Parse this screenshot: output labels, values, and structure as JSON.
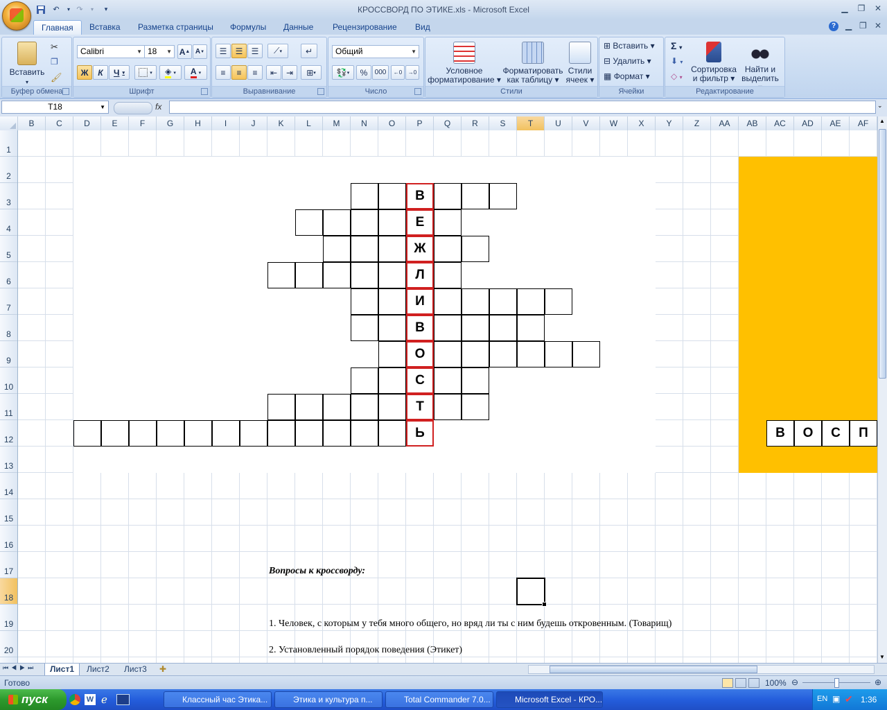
{
  "window": {
    "title": "КРОССВОРД ПО ЭТИКЕ.xls - Microsoft Excel",
    "quick_access_icons": [
      "save-icon",
      "undo-icon",
      "redo-icon",
      "customize-icon"
    ]
  },
  "ribbon": {
    "tabs": [
      "Главная",
      "Вставка",
      "Разметка страницы",
      "Формулы",
      "Данные",
      "Рецензирование",
      "Вид"
    ],
    "active_tab": "Главная",
    "groups": {
      "clipboard": {
        "label": "Буфер обмена",
        "paste": "Вставить"
      },
      "font": {
        "label": "Шрифт",
        "font_name": "Calibri",
        "font_size": "18",
        "bold": "Ж",
        "italic": "К",
        "underline": "Ч",
        "grow": "A",
        "shrink": "A",
        "font_color": "A"
      },
      "alignment": {
        "label": "Выравнивание"
      },
      "number": {
        "label": "Число",
        "format": "Общий",
        "percent": "%",
        "thousands": "000"
      },
      "styles": {
        "label": "Стили",
        "conditional": "Условное форматирование",
        "as_table": "Форматировать как таблицу",
        "cell_styles": "Стили ячеек"
      },
      "cells": {
        "label": "Ячейки",
        "insert": "Вставить",
        "delete": "Удалить",
        "format": "Формат"
      },
      "editing": {
        "label": "Редактирование",
        "sum": "Σ",
        "sort": "Сортировка и фильтр",
        "find": "Найти и выделить"
      }
    }
  },
  "formula_bar": {
    "name_box": "T18",
    "fx": "fx",
    "value": ""
  },
  "columns": [
    "B",
    "C",
    "D",
    "E",
    "F",
    "G",
    "H",
    "I",
    "J",
    "K",
    "L",
    "M",
    "N",
    "O",
    "P",
    "Q",
    "R",
    "S",
    "T",
    "U",
    "V",
    "W",
    "X",
    "Y",
    "Z",
    "AA",
    "AB",
    "AC",
    "AD",
    "AE",
    "AF"
  ],
  "selected_column": "T",
  "rows": [
    "1",
    "2",
    "3",
    "4",
    "5",
    "6",
    "7",
    "8",
    "9",
    "10",
    "11",
    "12",
    "13",
    "14",
    "15",
    "16",
    "17",
    "18",
    "19",
    "20"
  ],
  "selected_row": "18",
  "crossword": {
    "keyword": "ВЕЖЛИВОСТЬ",
    "keyword_letters": [
      "В",
      "Е",
      "Ж",
      "Л",
      "И",
      "В",
      "О",
      "С",
      "Т",
      "Ь"
    ],
    "right_letters": [
      "В",
      "О",
      "С",
      "П"
    ],
    "highlight_color": "#ffc000",
    "keyword_border_color": "#d02020"
  },
  "questions": {
    "heading": "Вопросы к кроссворду:",
    "items": [
      "1. Человек, с которым у тебя много общего, но вряд ли ты с ним будешь откровенным. (Товарищ)",
      "2. Установленный порядок поведения (Этикет)"
    ]
  },
  "sheets": {
    "tabs": [
      "Лист1",
      "Лист2",
      "Лист3"
    ],
    "active": "Лист1"
  },
  "status": {
    "text": "Готово",
    "zoom": "100%"
  },
  "taskbar": {
    "start": "пуск",
    "tasks": [
      "Классный час Этика...",
      "Этика и культура п...",
      "Total Commander 7.0...",
      "Microsoft Excel - КРО..."
    ],
    "active_task": 3,
    "lang": "EN",
    "clock": "1:36"
  }
}
